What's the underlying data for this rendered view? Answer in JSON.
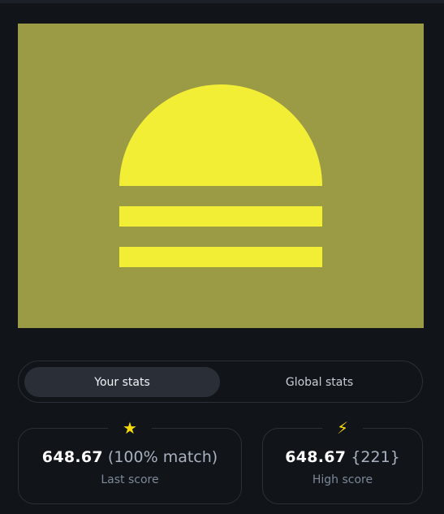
{
  "colors": {
    "art_bg": "#9b9a45",
    "art_fg": "#f2ee35",
    "accent": "#f5d90a"
  },
  "tabs": [
    {
      "label": "Your stats",
      "active": true
    },
    {
      "label": "Global stats",
      "active": false
    }
  ],
  "cards": [
    {
      "icon": "star-icon",
      "glyph": "★",
      "value": "648.67",
      "extra": "(100% match)",
      "label": "Last score"
    },
    {
      "icon": "lightning-icon",
      "glyph": "⚡",
      "value": "648.67",
      "extra": "{221}",
      "label": "High score"
    }
  ]
}
